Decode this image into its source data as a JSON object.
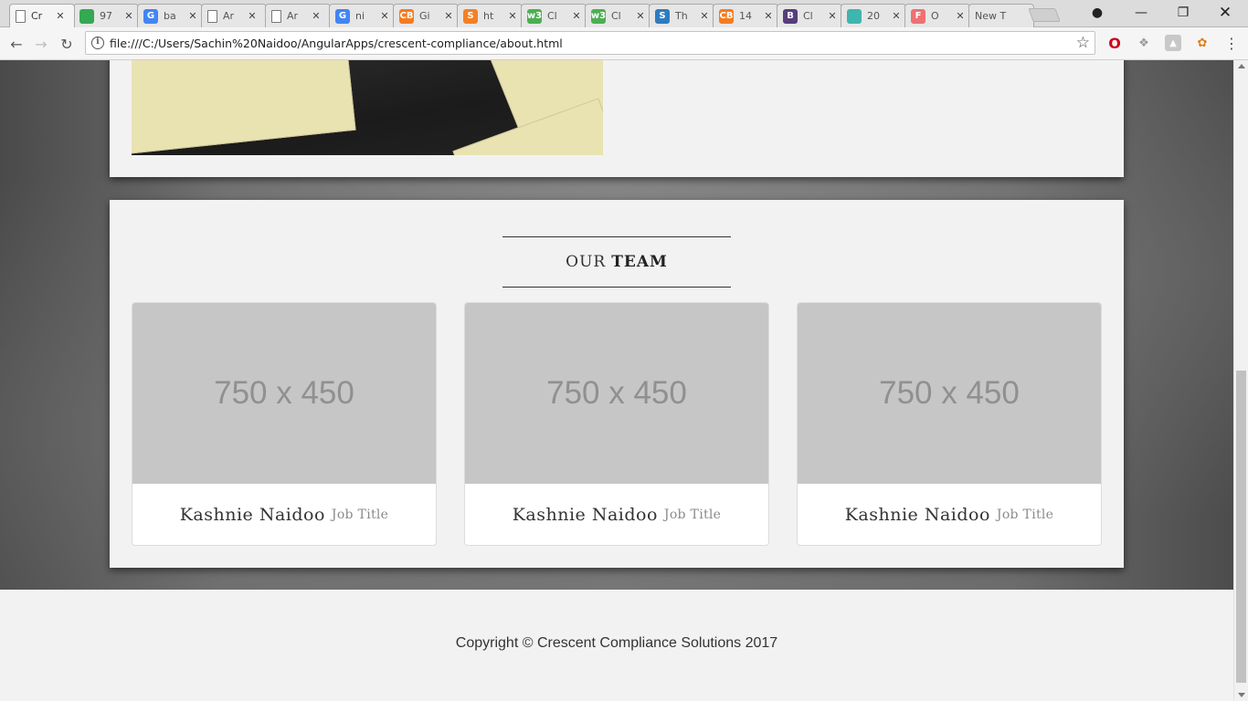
{
  "browser": {
    "tabs": [
      {
        "label": "Cr",
        "favicon": "page-icon",
        "favicon_text": "",
        "favicon_color": "#ffffff",
        "active": true
      },
      {
        "label": "97",
        "favicon": "google-maps-icon",
        "favicon_text": "",
        "favicon_color": "#34a853"
      },
      {
        "label": "ba",
        "favicon": "google-icon",
        "favicon_text": "G",
        "favicon_color": "#4285f4"
      },
      {
        "label": "Ar",
        "favicon": "page-icon",
        "favicon_text": "",
        "favicon_color": "#ffffff"
      },
      {
        "label": "Ar",
        "favicon": "page-icon",
        "favicon_text": "",
        "favicon_color": "#ffffff"
      },
      {
        "label": "ni",
        "favicon": "google-icon",
        "favicon_text": "G",
        "favicon_color": "#4285f4"
      },
      {
        "label": "Gi",
        "favicon": "code-icon",
        "favicon_text": "CB",
        "favicon_color": "#f47b20"
      },
      {
        "label": "ht",
        "favicon": "stackoverflow-icon",
        "favicon_text": "S",
        "favicon_color": "#f48024"
      },
      {
        "label": "Cl",
        "favicon": "w3schools-icon",
        "favicon_text": "w3",
        "favicon_color": "#4caf50"
      },
      {
        "label": "Cl",
        "favicon": "w3schools-icon",
        "favicon_text": "w3",
        "favicon_color": "#4caf50"
      },
      {
        "label": "Th",
        "favicon": "sitepoint-icon",
        "favicon_text": "S",
        "favicon_color": "#2f7bbf"
      },
      {
        "label": "14",
        "favicon": "code-icon",
        "favicon_text": "CB",
        "favicon_color": "#f47b20"
      },
      {
        "label": "Cl",
        "favicon": "bootstrap-icon",
        "favicon_text": "B",
        "favicon_color": "#563d7c"
      },
      {
        "label": "20",
        "favicon": "teal-square-icon",
        "favicon_text": "",
        "favicon_color": "#3fb5b0"
      },
      {
        "label": "O",
        "favicon": "f-circle-icon",
        "favicon_text": "F",
        "favicon_color": "#f07070"
      },
      {
        "label": "New T",
        "favicon": "",
        "favicon_text": "",
        "favicon_color": "#e6e6e6"
      }
    ],
    "url": "file:///C:/Users/Sachin%20Naidoo/AngularApps/crescent-compliance/about.html",
    "close_glyph": "✕",
    "window": {
      "minimize": "—",
      "restore": "❐",
      "close": "✕"
    },
    "nav": {
      "back": "←",
      "forward": "→",
      "reload": "↻"
    },
    "icons": {
      "info": "i",
      "star": "☆",
      "opera": "O",
      "puzzle": "❖",
      "pdf": "▲",
      "fox": "✿",
      "menu": "⋮",
      "profile": "●"
    }
  },
  "page": {
    "team_heading": {
      "light": "OUR",
      "bold": "TEAM"
    },
    "members": [
      {
        "image_placeholder": "750 x 450",
        "name": "Kashnie Naidoo",
        "title": "Job Title"
      },
      {
        "image_placeholder": "750 x 450",
        "name": "Kashnie Naidoo",
        "title": "Job Title"
      },
      {
        "image_placeholder": "750 x 450",
        "name": "Kashnie Naidoo",
        "title": "Job Title"
      }
    ],
    "footer": {
      "copyright": "Copyright © Crescent Compliance Solutions 2017"
    }
  }
}
